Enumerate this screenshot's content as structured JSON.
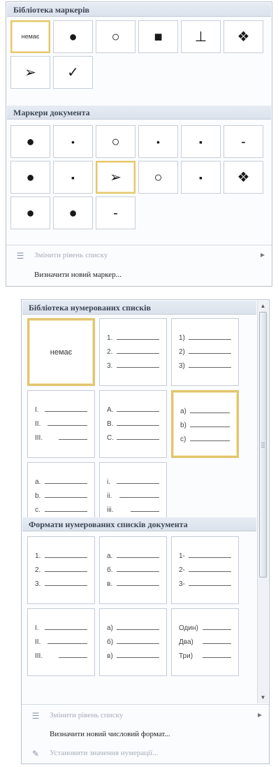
{
  "bullet_library": {
    "header": "Бібліотека маркерів",
    "items": [
      {
        "type": "none",
        "label": "немає",
        "icon": "none-icon",
        "selected": true
      },
      {
        "type": "symbol",
        "glyph": "●",
        "icon": "filled-circle-bullet-icon"
      },
      {
        "type": "symbol",
        "glyph": "○",
        "icon": "hollow-circle-bullet-icon"
      },
      {
        "type": "symbol",
        "glyph": "■",
        "icon": "filled-square-bullet-icon"
      },
      {
        "type": "symbol",
        "glyph": "⊥",
        "icon": "sparkle-bullet-icon"
      },
      {
        "type": "symbol",
        "glyph": "❖",
        "icon": "diamond-cluster-bullet-icon"
      },
      {
        "type": "symbol",
        "glyph": "➢",
        "icon": "arrowhead-bullet-icon"
      },
      {
        "type": "symbol",
        "glyph": "✓",
        "icon": "checkmark-bullet-icon"
      }
    ]
  },
  "document_bullets": {
    "header": "Маркери документа",
    "items": [
      {
        "glyph": "●",
        "icon": "filled-circle-bullet-icon"
      },
      {
        "glyph": "•",
        "icon": "small-dot-bullet-icon"
      },
      {
        "glyph": "○",
        "icon": "hollow-circle-bullet-icon"
      },
      {
        "glyph": "•",
        "icon": "small-dot-bullet-icon"
      },
      {
        "glyph": "▪",
        "icon": "small-square-bullet-icon"
      },
      {
        "glyph": "-",
        "icon": "dash-bullet-icon"
      },
      {
        "glyph": "●",
        "icon": "filled-circle-bullet-icon"
      },
      {
        "glyph": "▪",
        "icon": "small-square-bullet-icon"
      },
      {
        "glyph": "➢",
        "icon": "arrowhead-bullet-icon",
        "selected": true
      },
      {
        "glyph": "○",
        "icon": "hollow-circle-bullet-icon"
      },
      {
        "glyph": "▪",
        "icon": "small-square-bullet-icon"
      },
      {
        "glyph": "❖",
        "icon": "diamond-cluster-bullet-icon"
      },
      {
        "glyph": "●",
        "icon": "filled-circle-bullet-icon"
      },
      {
        "glyph": "●",
        "icon": "filled-circle-bullet-icon"
      },
      {
        "glyph": "-",
        "icon": "dash-bullet-icon"
      }
    ]
  },
  "bullet_menu": {
    "change_level": {
      "label": "Змінити рівень списку",
      "icon": "list-level-icon",
      "arrow": "▸",
      "enabled": false
    },
    "define_new": {
      "label": "Визначити новий маркер...",
      "enabled": true
    }
  },
  "numbering_library": {
    "header": "Бібліотека нумерованих списків",
    "items": [
      {
        "type": "none",
        "label": "немає",
        "selected": true
      },
      {
        "type": "list",
        "labels": [
          "1.",
          "2.",
          "3."
        ]
      },
      {
        "type": "list",
        "labels": [
          "1)",
          "2)",
          "3)"
        ]
      },
      {
        "type": "list",
        "labels": [
          "I.",
          "II.",
          "III."
        ]
      },
      {
        "type": "list",
        "labels": [
          "A.",
          "B.",
          "C."
        ]
      },
      {
        "type": "list",
        "labels": [
          "a)",
          "b)",
          "c)"
        ],
        "selected": true
      },
      {
        "type": "list",
        "labels": [
          "a.",
          "b.",
          "c."
        ]
      },
      {
        "type": "list",
        "labels": [
          "i.",
          "ii.",
          "iii."
        ]
      }
    ]
  },
  "document_numbering": {
    "header": "Формати нумерованих списків документа",
    "items": [
      {
        "labels": [
          "1.",
          "2.",
          "3."
        ]
      },
      {
        "labels": [
          "а.",
          "б.",
          "в."
        ]
      },
      {
        "labels": [
          "1-",
          "2-",
          "3-"
        ]
      },
      {
        "labels": [
          "I.",
          "II.",
          "III."
        ]
      },
      {
        "labels": [
          "а)",
          "б)",
          "в)"
        ]
      },
      {
        "labels": [
          "Один)",
          "Два)",
          "Три)"
        ]
      }
    ]
  },
  "numbering_menu": {
    "change_level": {
      "label": "Змінити рівень списку",
      "icon": "list-level-icon",
      "arrow": "▸",
      "enabled": false
    },
    "define_new": {
      "label": "Визначити новий числовий формат...",
      "enabled": true
    },
    "set_value": {
      "label": "Установити значення нумерації...",
      "icon": "numbering-value-icon",
      "enabled": false
    }
  },
  "scrollbar": {
    "up_glyph": "▲",
    "down_glyph": "▼"
  }
}
